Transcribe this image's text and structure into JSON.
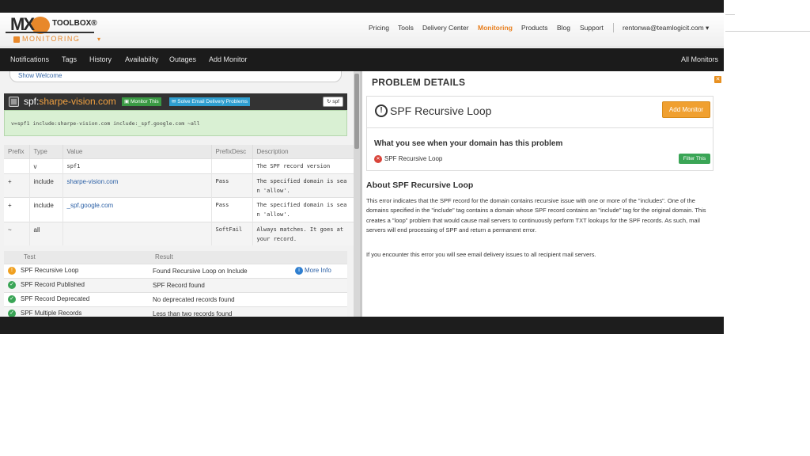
{
  "header": {
    "logo": {
      "brand": "MX",
      "toolbox": "TOOLBOX®",
      "product": "MONITORING",
      "caret": "▾"
    },
    "nav": [
      "Pricing",
      "Tools",
      "Delivery Center",
      "Monitoring",
      "Products",
      "Blog",
      "Support"
    ],
    "active_nav": "Monitoring",
    "user": "rentonwa@teamlogicit.com ▾"
  },
  "subnav": {
    "items": [
      "Notifications",
      "Tags",
      "History",
      "Availability",
      "Outages",
      "Add Monitor"
    ],
    "right": "All Monitors"
  },
  "left": {
    "welcome": "Show Welcome",
    "spf_prefix": "spf:",
    "domain": "sharpe-vision.com",
    "monitor_btn": "Monitor This",
    "solve_btn": "Solve Email Delivery Problems",
    "spf_btn": "spf",
    "record": "v=spf1 include:sharpe-vision.com include:_spf.google.com ~all",
    "record_table": {
      "headers": [
        "Prefix",
        "Type",
        "Value",
        "PrefixDesc",
        "Description"
      ],
      "rows": [
        [
          "",
          "v",
          "spf1",
          "",
          "The SPF record version"
        ],
        [
          "+",
          "include",
          "sharpe-vision.com",
          "Pass",
          "The specified domain is sea n 'allow'."
        ],
        [
          "+",
          "include",
          "_spf.google.com",
          "Pass",
          "The specified domain is sea n 'allow'."
        ],
        [
          "~",
          "all",
          "",
          "SoftFail",
          "Always matches. It goes at your record."
        ]
      ]
    },
    "test_table": {
      "headers": [
        "Test",
        "Result"
      ],
      "rows": [
        {
          "status": "warning",
          "test": "SPF Recursive Loop",
          "result": "Found Recursive Loop on Include",
          "more": "More Info"
        },
        {
          "status": "ok",
          "test": "SPF Record Published",
          "result": "SPF Record found",
          "more": ""
        },
        {
          "status": "ok",
          "test": "SPF Record Deprecated",
          "result": "No deprecated records found",
          "more": ""
        },
        {
          "status": "ok",
          "test": "SPF Multiple Records",
          "result": "Less than two records found",
          "more": ""
        }
      ]
    }
  },
  "right": {
    "title": "PROBLEM DETAILS",
    "problem": "SPF Recursive Loop",
    "add_monitor": "Add Monitor",
    "see_title": "What you see when your domain has this problem",
    "see_item": "SPF Recursive Loop",
    "filter_btn": "Filter This",
    "about_title": "About SPF Recursive Loop",
    "about_text": "This error indicates that the SPF record for the domain contains recursive issue with one or more of the \"includes\". One of the domains specified in the \"include\" tag contains a domain whose SPF record contains an \"include\" tag for the original domain. This creates a \"loop\" problem that would cause mail servers to continuously perform TXT lookups for the SPF records. As such, mail servers will end processing of SPF and return a permanent error.",
    "about_text2": "If you encounter this error you will see email delivery issues to all recipient mail servers."
  },
  "colors": {
    "accent": "#e87f1e",
    "nav_bg": "#1b1b1b",
    "ok": "#3aa556",
    "warning": "#f0a020",
    "error": "#d9443a"
  }
}
